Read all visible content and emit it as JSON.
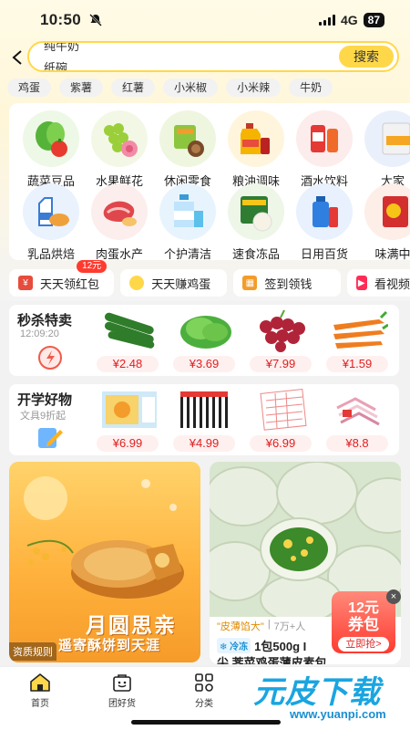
{
  "status": {
    "time": "10:50",
    "network": "4G",
    "battery": "87"
  },
  "search": {
    "query_line1": "纯牛奶",
    "query_line2": "纸碗",
    "button": "搜索"
  },
  "chips": [
    "鸡蛋",
    "紫薯",
    "红薯",
    "小米椒",
    "小米辣",
    "牛奶"
  ],
  "categories": [
    {
      "label": "蔬菜豆品",
      "icon": "vegetables-icon"
    },
    {
      "label": "水果鲜花",
      "icon": "fruit-icon"
    },
    {
      "label": "休闲零食",
      "icon": "snacks-icon"
    },
    {
      "label": "粮油调味",
      "icon": "oil-icon"
    },
    {
      "label": "酒水饮料",
      "icon": "drinks-icon"
    },
    {
      "label": "大家",
      "icon": "more-icon"
    },
    {
      "label": "乳品烘焙",
      "icon": "dairy-icon"
    },
    {
      "label": "肉蛋水产",
      "icon": "meat-icon"
    },
    {
      "label": "个护清洁",
      "icon": "cleaning-icon"
    },
    {
      "label": "速食冻品",
      "icon": "frozen-icon"
    },
    {
      "label": "日用百货",
      "icon": "daily-icon"
    },
    {
      "label": "味满中",
      "icon": "more2-icon"
    }
  ],
  "promos": [
    {
      "label": "天天领红包",
      "badge": "12元"
    },
    {
      "label": "天天赚鸡蛋"
    },
    {
      "label": "签到领钱"
    },
    {
      "label": "看视频"
    }
  ],
  "flash_sale": {
    "title": "秒杀特卖",
    "subtitle": "12:09:20",
    "items": [
      {
        "name": "黄瓜",
        "price": "¥2.48"
      },
      {
        "name": "生菜",
        "price": "¥3.69"
      },
      {
        "name": "葡萄",
        "price": "¥7.99"
      },
      {
        "name": "胡萝卜",
        "price": "¥1.59"
      }
    ]
  },
  "school": {
    "title": "开学好物",
    "subtitle": "文具9折起",
    "items": [
      {
        "name": "书套",
        "price": "¥6.99"
      },
      {
        "name": "中性笔",
        "price": "¥4.99"
      },
      {
        "name": "作业本",
        "price": "¥6.99"
      },
      {
        "name": "衣架",
        "price": "¥8.8"
      }
    ]
  },
  "feed": {
    "left": {
      "headline": "月圆思亲",
      "sub": "遥寄酥饼到天涯",
      "tag": "资质规则"
    },
    "right": {
      "tag": "\"皮薄馅大\"",
      "sold": "7万+人",
      "frozen": "冷冻",
      "title_line1": "1包500g I",
      "title_line2": "尖 荠菜鸡蛋薄皮素包",
      "coupon_amount": "12元",
      "coupon_word": "券包",
      "coupon_btn": "立即抢>"
    }
  },
  "tabs": [
    {
      "label": "首页",
      "icon": "home-icon"
    },
    {
      "label": "团好货",
      "icon": "shop-icon"
    },
    {
      "label": "分类",
      "icon": "grid-icon"
    }
  ],
  "watermark": {
    "main": "元皮下载",
    "url": "www.yuanpi.com"
  }
}
